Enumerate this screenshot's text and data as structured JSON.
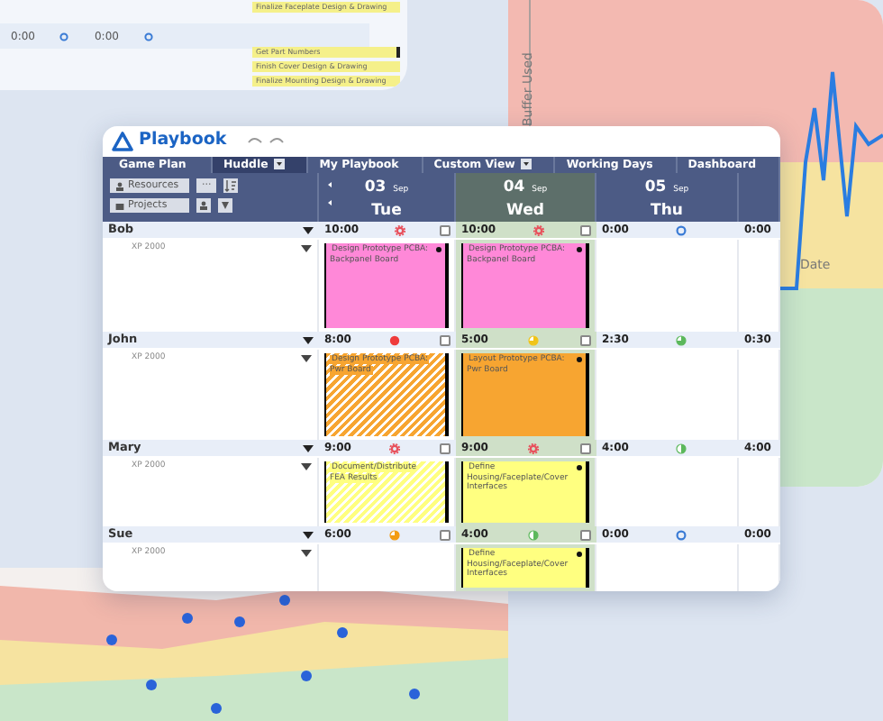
{
  "back_card": {
    "times": [
      "0:00",
      "0:00"
    ],
    "tasks": [
      {
        "title": "Finalize Faceplate Design & Drawing",
        "pinned": false
      },
      {
        "title": "Get Part Numbers",
        "pinned": true
      },
      {
        "title": "Finish Cover Design & Drawing",
        "pinned": false
      },
      {
        "title": "Finalize Mounting Design & Drawing",
        "pinned": false
      }
    ]
  },
  "side_chart": {
    "ylabel": "Buffer Used",
    "xlabel": "Date"
  },
  "window": {
    "title": "Playbook"
  },
  "tabs": [
    {
      "label": "Game Plan",
      "selected": false,
      "dropdown": false
    },
    {
      "label": "Huddle",
      "selected": true,
      "dropdown": true
    },
    {
      "label": "My Playbook",
      "selected": false,
      "dropdown": false
    },
    {
      "label": "Custom View",
      "selected": false,
      "dropdown": true
    },
    {
      "label": "Working Days",
      "selected": false,
      "dropdown": false
    },
    {
      "label": "Dashboard",
      "selected": false,
      "dropdown": false
    }
  ],
  "toolbar": {
    "resources": "Resources",
    "projects": "Projects",
    "more": "···"
  },
  "days": [
    {
      "num": "03",
      "month": "Sep",
      "name": "Tue",
      "selected": false
    },
    {
      "num": "04",
      "month": "Sep",
      "name": "Wed",
      "selected": true
    },
    {
      "num": "05",
      "month": "Sep",
      "name": "Thu",
      "selected": false
    }
  ],
  "rows": [
    {
      "name": "Bob",
      "sub": "XP 2000",
      "cells": [
        {
          "time": "10:00",
          "status": {
            "kind": "gear",
            "color": "#e8505b"
          },
          "checked": false,
          "task": {
            "title": "Design Prototype PCBA: Backpanel Board",
            "color": "#ff88d8",
            "hatched": false,
            "pinned": true
          }
        },
        {
          "time": "10:00",
          "status": {
            "kind": "gear",
            "color": "#e8505b"
          },
          "checked": false,
          "task": {
            "title": "Design Prototype PCBA: Backpanel Board",
            "color": "#ff88d8",
            "hatched": false,
            "pinned": true
          }
        },
        {
          "time": "0:00",
          "status": {
            "kind": "ring",
            "color": "#3a7bd5"
          }
        },
        {
          "time": "0:00"
        }
      ]
    },
    {
      "name": "John",
      "sub": "XP 2000",
      "cells": [
        {
          "time": "8:00",
          "status": {
            "kind": "dot",
            "color": "#ef3b3b"
          },
          "checked": false,
          "task": {
            "title": "Design Prototype PCBA: Pwr Board",
            "color": "#f7a531",
            "hatched": true,
            "pinned": false
          }
        },
        {
          "time": "5:00",
          "status": {
            "kind": "pie",
            "color": "#f0c419"
          },
          "checked": false,
          "task": {
            "title": "Layout Prototype PCBA: Pwr Board",
            "color": "#f7a531",
            "hatched": false,
            "pinned": true
          }
        },
        {
          "time": "2:30",
          "status": {
            "kind": "pie",
            "color": "#5cb85c"
          }
        },
        {
          "time": "0:30"
        }
      ]
    },
    {
      "name": "Mary",
      "sub": "XP 2000",
      "cells": [
        {
          "time": "9:00",
          "status": {
            "kind": "gear",
            "color": "#e8505b"
          },
          "checked": false,
          "task": {
            "title": "Document/Distribute FEA Results",
            "color": "#ffff80",
            "hatched": true,
            "pinned": false
          }
        },
        {
          "time": "9:00",
          "status": {
            "kind": "gear",
            "color": "#e8505b"
          },
          "checked": false,
          "task": {
            "title": "Define Housing/Faceplate/Cover Interfaces",
            "color": "#ffff80",
            "hatched": false,
            "pinned": true
          }
        },
        {
          "time": "4:00",
          "status": {
            "kind": "half",
            "color": "#5cb85c"
          }
        },
        {
          "time": "4:00"
        }
      ]
    },
    {
      "name": "Sue",
      "sub": "XP 2000",
      "cells": [
        {
          "time": "6:00",
          "status": {
            "kind": "pie",
            "color": "#f39c12"
          },
          "checked": false
        },
        {
          "time": "4:00",
          "status": {
            "kind": "half",
            "color": "#5cb85c"
          },
          "checked": false,
          "task": {
            "title": "Define Housing/Faceplate/Cover Interfaces",
            "color": "#ffff80",
            "hatched": false,
            "pinned": true
          }
        },
        {
          "time": "0:00",
          "status": {
            "kind": "ring",
            "color": "#3a7bd5"
          }
        },
        {
          "time": "0:00"
        }
      ]
    }
  ]
}
